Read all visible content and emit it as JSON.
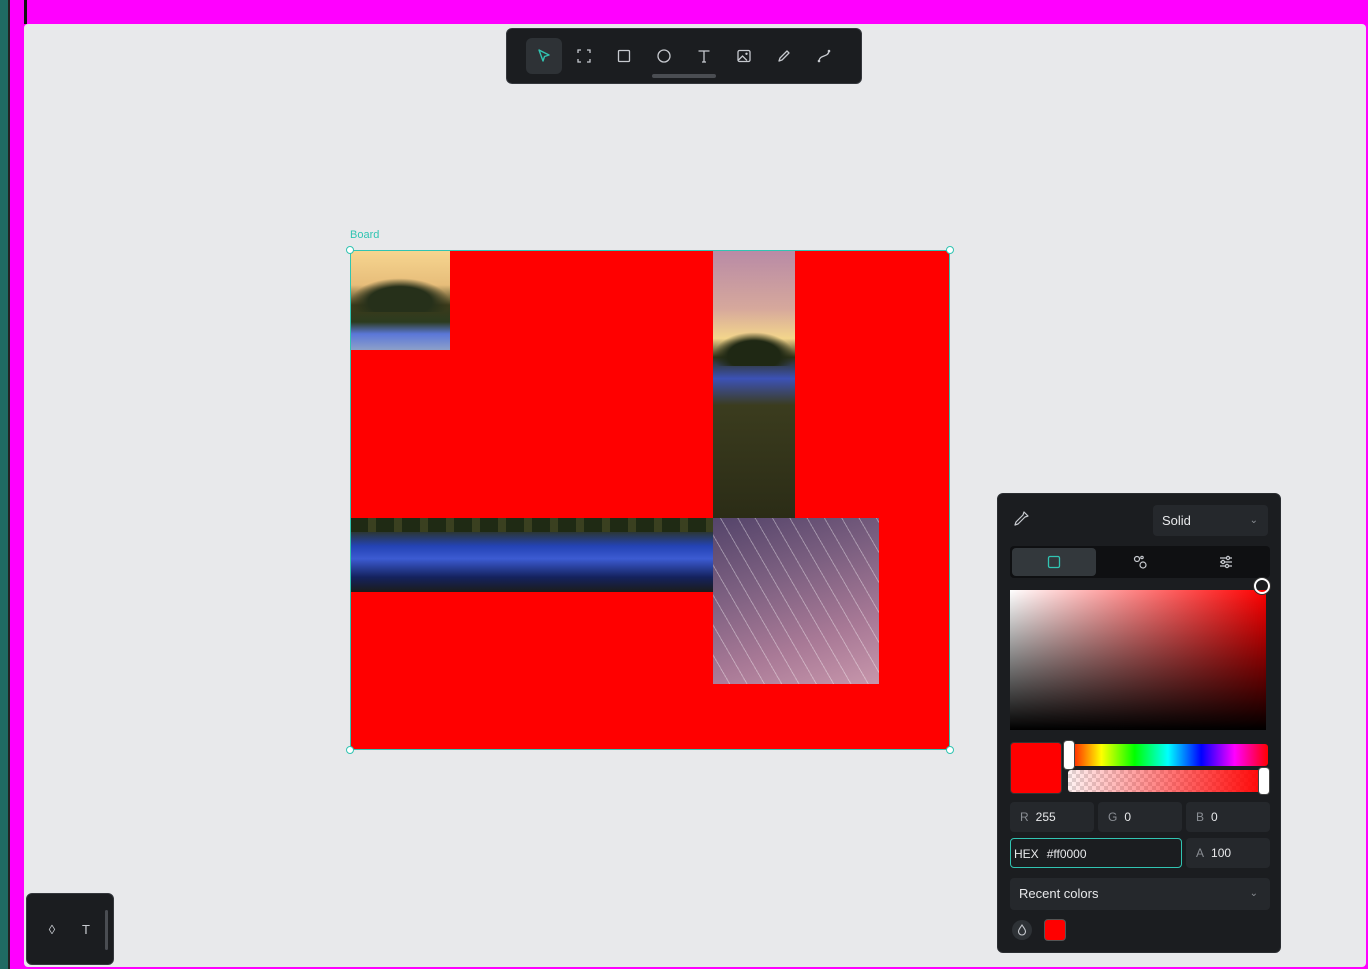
{
  "board": {
    "label": "Board",
    "fill": "#ff0000"
  },
  "toolbar": {
    "tools": [
      {
        "name": "move",
        "icon": "pointer-icon",
        "active": true
      },
      {
        "name": "board",
        "icon": "frame-icon"
      },
      {
        "name": "rectangle",
        "icon": "rectangle-icon"
      },
      {
        "name": "ellipse",
        "icon": "ellipse-icon"
      },
      {
        "name": "text",
        "icon": "text-icon"
      },
      {
        "name": "image",
        "icon": "image-icon"
      },
      {
        "name": "pencil",
        "icon": "pencil-icon"
      },
      {
        "name": "path",
        "icon": "path-icon"
      }
    ]
  },
  "layers_panel": {
    "icons": [
      "drop-icon",
      "text-icon"
    ],
    "text_glyph": "T",
    "drop_glyph": "◊"
  },
  "color_picker": {
    "fill_type": "Solid",
    "tabs": [
      "square-icon",
      "palette-icon",
      "sliders-icon"
    ],
    "rgb": {
      "r_label": "R",
      "r": "255",
      "g_label": "G",
      "g": "0",
      "b_label": "B",
      "b": "0"
    },
    "hex_label": "HEX",
    "hex": "#ff0000",
    "hex_display": "#ff0000",
    "alpha_label": "A",
    "alpha": "100",
    "recent_label": "Recent colors",
    "recent_swatches": [
      "#ff0000"
    ],
    "current_color": "#ff0000",
    "hue_level": 0,
    "alpha_level": 1
  },
  "accent": "#31c4b2"
}
